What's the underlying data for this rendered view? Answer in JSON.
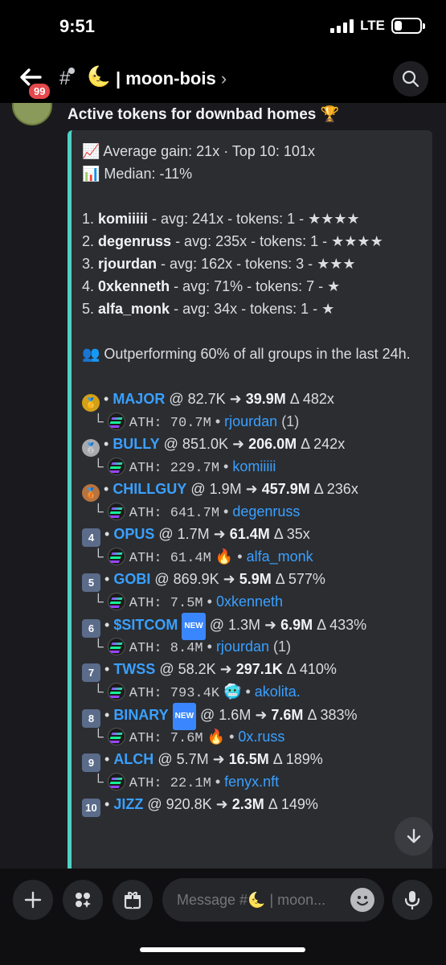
{
  "status": {
    "time": "9:51",
    "network": "LTE",
    "battery_level": 0.3
  },
  "header": {
    "badge": "99",
    "channel_emoji": "🌜",
    "title": "| moon-bois",
    "chevron": "›",
    "icons": [
      "back-arrow-icon",
      "thread-channel-icon",
      "search-icon"
    ]
  },
  "message": {
    "heading": "Active tokens for downbad homes 🏆",
    "stats": [
      "📈 Average gain: 21x · Top 10: 101x",
      "📊 Median: -11%"
    ],
    "leaders": [
      {
        "num": "1.",
        "name": "komiiiii",
        "rest": " - avg: 241x - tokens: 1 - ★★★★"
      },
      {
        "num": "2.",
        "name": "degenruss",
        "rest": " - avg: 235x - tokens: 1 - ★★★★"
      },
      {
        "num": "3.",
        "name": "rjourdan",
        "rest": " - avg: 162x - tokens: 3 - ★★★"
      },
      {
        "num": "4.",
        "name": "0xkenneth",
        "rest": " - avg: 71% - tokens: 7 - ★"
      },
      {
        "num": "5.",
        "name": "alfa_monk",
        "rest": " - avg: 34x - tokens: 1 - ★"
      }
    ],
    "outperform": "👥 Outperforming 60% of all groups in the last 24h.",
    "tokens": [
      {
        "rank": "🥇",
        "rank_color": "#d4a017",
        "name": "MAJOR",
        "is_new": false,
        "entry": " @ 82.7K ",
        "arrow": "➜",
        "peak": " 39.9M",
        "delta": " Δ 482x",
        "ath": "ATH: 70.7M",
        "ath_emoji": "",
        "caller": "rjourdan",
        "caller_suffix": " (1)"
      },
      {
        "rank": "🥈",
        "rank_color": "#a7a9ad",
        "name": "BULLY",
        "is_new": false,
        "entry": " @ 851.0K ",
        "arrow": "➜",
        "peak": " 206.0M",
        "delta": " Δ 242x",
        "ath": "ATH: 229.7M",
        "ath_emoji": "",
        "caller": "komiiiii",
        "caller_suffix": ""
      },
      {
        "rank": "🥉",
        "rank_color": "#b8733f",
        "name": "CHILLGUY",
        "is_new": false,
        "entry": " @ 1.9M ",
        "arrow": "➜",
        "peak": " 457.9M",
        "delta": " Δ 236x",
        "ath": "ATH: 641.7M",
        "ath_emoji": "",
        "caller": "degenruss",
        "caller_suffix": ""
      },
      {
        "rank": "4",
        "rank_color": "",
        "name": "OPUS",
        "is_new": false,
        "entry": " @ 1.7M ",
        "arrow": "➜",
        "peak": " 61.4M",
        "delta": " Δ 35x",
        "ath": "ATH: 61.4M",
        "ath_emoji": "🔥",
        "caller": "alfa_monk",
        "caller_suffix": ""
      },
      {
        "rank": "5",
        "rank_color": "",
        "name": "GOBI",
        "is_new": false,
        "entry": " @ 869.9K ",
        "arrow": "➜",
        "peak": " 5.9M",
        "delta": " Δ 577%",
        "ath": "ATH: 7.5M",
        "ath_emoji": "",
        "caller": "0xkenneth",
        "caller_suffix": ""
      },
      {
        "rank": "6",
        "rank_color": "",
        "name": "$SITCOM",
        "is_new": true,
        "entry": " @ 1.3M ",
        "arrow": "➜",
        "peak": " 6.9M",
        "delta": " Δ 433%",
        "ath": "ATH: 8.4M",
        "ath_emoji": "",
        "caller": "rjourdan",
        "caller_suffix": " (1)"
      },
      {
        "rank": "7",
        "rank_color": "",
        "name": "TWSS",
        "is_new": false,
        "entry": " @ 58.2K ",
        "arrow": "➜",
        "peak": " 297.1K",
        "delta": " Δ 410%",
        "ath": "ATH: 793.4K",
        "ath_emoji": "🥶",
        "caller": "akolita.",
        "caller_suffix": ""
      },
      {
        "rank": "8",
        "rank_color": "",
        "name": "BINARY",
        "is_new": true,
        "entry": " @ 1.6M ",
        "arrow": "➜",
        "peak": " 7.6M",
        "delta": " Δ 383%",
        "ath": "ATH: 7.6M",
        "ath_emoji": "🔥",
        "caller": "0x.russ",
        "caller_suffix": ""
      },
      {
        "rank": "9",
        "rank_color": "",
        "name": "ALCH",
        "is_new": false,
        "entry": " @ 5.7M ",
        "arrow": "➜",
        "peak": " 16.5M",
        "delta": " Δ 189%",
        "ath": "ATH: 22.1M",
        "ath_emoji": "",
        "caller": "fenyx.nft",
        "caller_suffix": ""
      },
      {
        "rank": "10",
        "rank_color": "",
        "name": "JIZZ",
        "is_new": false,
        "entry": " @ 920.8K ",
        "arrow": "➜",
        "peak": " 2.3M",
        "delta": " Δ 149%",
        "ath": "",
        "ath_emoji": "",
        "caller": "",
        "caller_suffix": ""
      }
    ],
    "new_badge": "NEW",
    "sub_prefix": "└",
    "bullet": " • "
  },
  "composer": {
    "placeholder": "Message #🌜 | moon..."
  }
}
